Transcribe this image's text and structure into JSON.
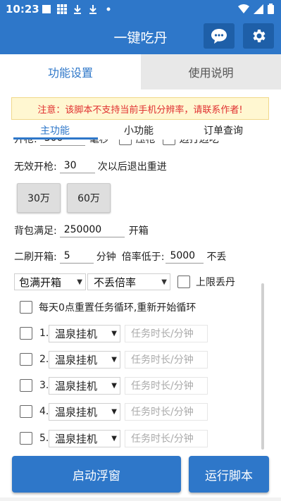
{
  "status_bar": {
    "time": "10:23",
    "icons": [
      "square-icon",
      "grid-icon",
      "download-icon",
      "download-icon",
      "dot-icon"
    ],
    "right_icons": [
      "wifi-icon",
      "signal-icon",
      "battery-icon"
    ]
  },
  "app_bar": {
    "title": "一键吃丹",
    "chat_icon": "chat-icon",
    "settings_icon": "gear-icon"
  },
  "main_tabs": [
    {
      "label": "功能设置",
      "active": true
    },
    {
      "label": "使用说明",
      "active": false
    }
  ],
  "notice": "注意：该脚本不支持当前手机分辨率，请联系作者!",
  "sub_tabs": [
    {
      "label": "主功能",
      "active": true
    },
    {
      "label": "小功能",
      "active": false
    },
    {
      "label": "订单查询",
      "active": false
    }
  ],
  "partial_row": {
    "label": "开枪:",
    "value": "300",
    "unit": "毫秒",
    "cb1_label": "压枪",
    "cb2_label": "边打边吃"
  },
  "invalid_fire": {
    "label": "无效开枪:",
    "value": "30",
    "suffix": "次以后退出重进"
  },
  "preset_buttons": [
    "30万",
    "60万"
  ],
  "bag_full": {
    "label": "背包满足:",
    "value": "250000",
    "suffix": "开箱"
  },
  "second_open": {
    "label": "二刷开箱:",
    "value": "5",
    "unit": "分钟",
    "rate_label": "倍率低于:",
    "rate_value": "5000",
    "rate_suffix": "不丢"
  },
  "dropdowns": {
    "box_mode": "包满开箱",
    "rate_mode": "不丢倍率",
    "cap_label": "上限丢丹"
  },
  "daily_reset": {
    "label": "每天0点重置任务循环,重新开始循环",
    "checked": false
  },
  "tasks": [
    {
      "num": "1.",
      "select": "温泉挂机",
      "placeholder": "任务时长/分钟"
    },
    {
      "num": "2.",
      "select": "温泉挂机",
      "placeholder": "任务时长/分钟"
    },
    {
      "num": "3.",
      "select": "温泉挂机",
      "placeholder": "任务时长/分钟"
    },
    {
      "num": "4.",
      "select": "温泉挂机",
      "placeholder": "任务时长/分钟"
    },
    {
      "num": "5.",
      "select": "温泉挂机",
      "placeholder": "任务时长/分钟"
    }
  ],
  "bottom": {
    "float_button": "启动浮窗",
    "run_button": "运行脚本"
  },
  "colors": {
    "primary": "#2e77c9",
    "notice_text": "#e03030",
    "notice_bg": "#fff7d1"
  }
}
